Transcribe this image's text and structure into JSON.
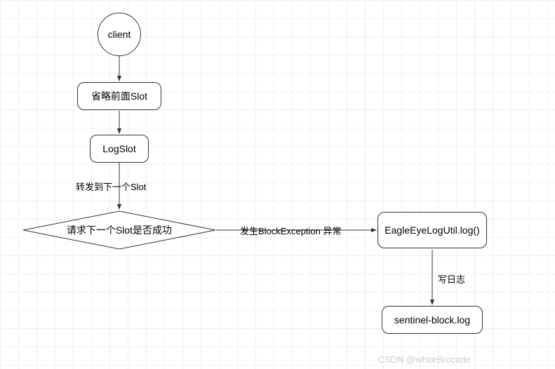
{
  "chart_data": {
    "type": "flowchart",
    "title": "",
    "nodes": [
      {
        "id": "client",
        "kind": "start",
        "label": "client"
      },
      {
        "id": "omit",
        "kind": "process",
        "label": "省略前面Slot"
      },
      {
        "id": "logslot",
        "kind": "process",
        "label": "LogSlot"
      },
      {
        "id": "decision",
        "kind": "decision",
        "label": "请求下一个Slot是否成功"
      },
      {
        "id": "eagle",
        "kind": "process",
        "label": "EagleEyeLogUtil.log()"
      },
      {
        "id": "sentinel",
        "kind": "process",
        "label": "sentinel-block.log"
      }
    ],
    "edges": [
      {
        "from": "client",
        "to": "omit",
        "label": ""
      },
      {
        "from": "omit",
        "to": "logslot",
        "label": ""
      },
      {
        "from": "logslot",
        "to": "decision",
        "label": "转发到下一个Slot"
      },
      {
        "from": "decision",
        "to": "eagle",
        "label": "发生BlockException 异常"
      },
      {
        "from": "eagle",
        "to": "sentinel",
        "label": "写日志"
      }
    ]
  },
  "nodes": {
    "client": "client",
    "omit": "省略前面Slot",
    "logslot": "LogSlot",
    "decision": "请求下一个Slot是否成功",
    "eagle": "EagleEyeLogUtil.log()",
    "sentinel": "sentinel-block.log"
  },
  "edges": {
    "logslot_decision": "转发到下一个Slot",
    "decision_eagle": "发生BlockException 异常",
    "eagle_sentinel": "写日志"
  },
  "watermark": "CSDN @whiteBrocade"
}
